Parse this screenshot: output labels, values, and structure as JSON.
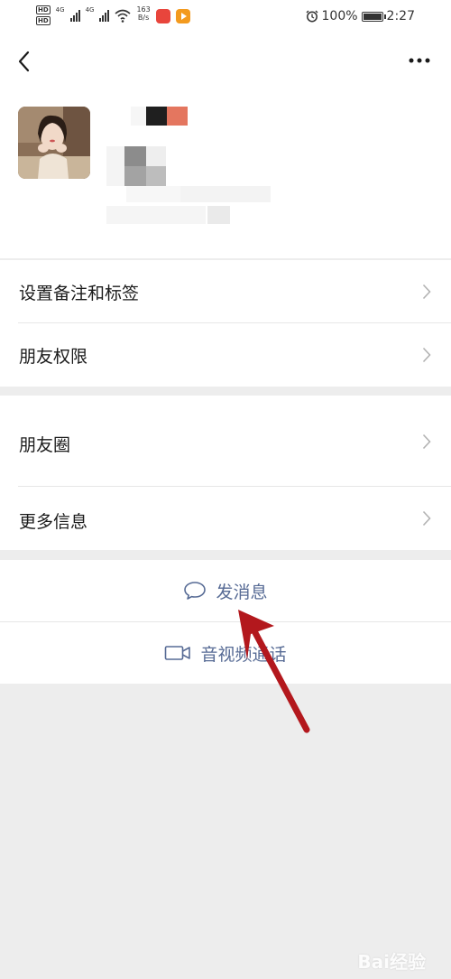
{
  "status_bar": {
    "hd1": "HD",
    "hd2": "HD",
    "net1": "4G",
    "net2": "4G",
    "speed_value": "163",
    "speed_unit": "B/s",
    "battery": "100%",
    "time": "2:27"
  },
  "menu": {
    "set_remark": "设置备注和标签",
    "friend_permission": "朋友权限",
    "moments": "朋友圈",
    "more_info": "更多信息"
  },
  "actions": {
    "send_message": "发消息",
    "video_call": "音视频通话"
  },
  "colors": {
    "link_blue": "#576b95",
    "background": "#ededed",
    "arrow_red": "#b3181d"
  },
  "watermark": "Bai经验"
}
